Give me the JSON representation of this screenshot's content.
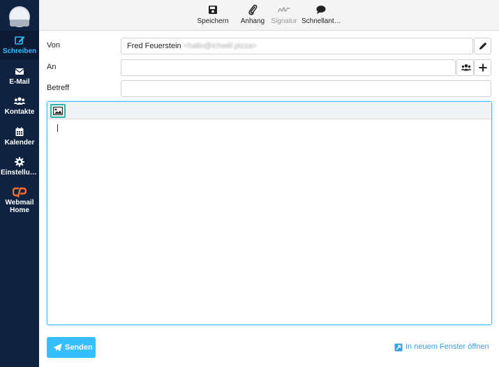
{
  "sidebar": {
    "items": [
      {
        "label": "Schreiben",
        "icon": "compose-icon"
      },
      {
        "label": "E-Mail",
        "icon": "envelope-icon"
      },
      {
        "label": "Kontakte",
        "icon": "contacts-icon"
      },
      {
        "label": "Kalender",
        "icon": "calendar-icon"
      },
      {
        "label": "Einstellung…",
        "icon": "gear-icon"
      },
      {
        "label": "Webmail",
        "label2": "Home",
        "icon": "cpanel-icon"
      }
    ]
  },
  "toolbar": {
    "save": "Speichern",
    "attach": "Anhang",
    "signature": "Signatur",
    "quick": "Schnellant…"
  },
  "form": {
    "from_label": "Von",
    "from_name": "Fred Feuerstein",
    "from_email": "<hallo@ichwill.pizza>",
    "to_label": "An",
    "to_value": "",
    "subject_label": "Betreff",
    "subject_value": ""
  },
  "footer": {
    "send": "Senden",
    "new_window": "In neuem Fenster öffnen"
  },
  "colors": {
    "sidebar_bg": "#0f2240",
    "accent": "#37beff",
    "cpanel_orange": "#ff6c2c",
    "image_button_border": "#2ab7a9"
  }
}
